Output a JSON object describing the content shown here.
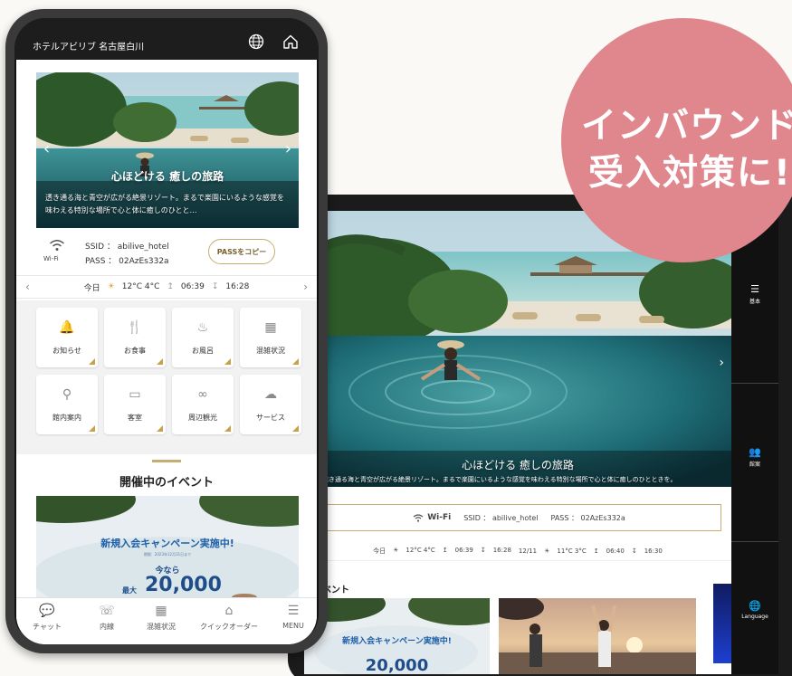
{
  "badge": {
    "line1": "インバウンド",
    "line2": "受入対策に!"
  },
  "phone": {
    "header": {
      "title": "ホテルアビリブ 名古屋白川",
      "globe_icon": "globe-icon",
      "home_icon": "home-icon"
    },
    "hero": {
      "title": "心ほどける 癒しの旅路",
      "subtitle": "透き通る海と青空が広がる絶景リゾート。まるで楽園にいるような感覚を味わえる特別な場所で心と体に癒しのひとと…",
      "prev": "‹",
      "next": "›"
    },
    "wifi": {
      "label": "Wi-Fi",
      "ssid": "SSID ： abilive_hotel",
      "pass": "PASS ： 02AzEs332a",
      "copy_button": "PASSをコピー"
    },
    "weather": {
      "day": "今日",
      "temp": "12°C 4°C",
      "sunrise": "06:39",
      "sunset": "16:28",
      "prev": "‹",
      "next": "›"
    },
    "tiles": [
      {
        "label": "お知らせ",
        "icon": "bell-icon"
      },
      {
        "label": "お食事",
        "icon": "dining-icon"
      },
      {
        "label": "お風呂",
        "icon": "bath-icon"
      },
      {
        "label": "混雑状況",
        "icon": "crowd-icon"
      },
      {
        "label": "館内案内",
        "icon": "map-icon"
      },
      {
        "label": "客室",
        "icon": "bed-icon"
      },
      {
        "label": "周辺観光",
        "icon": "binoculars-icon"
      },
      {
        "label": "サービス",
        "icon": "service-icon"
      }
    ],
    "events": {
      "title": "開催中のイベント",
      "card_title": "新規入会キャンペーン実施中!",
      "card_small": "期限：2023年12月31日まで",
      "card_now": "今なら",
      "card_max": "最大",
      "card_amount": "20,000"
    },
    "nav": [
      {
        "label": "チャット",
        "icon": "chat-icon"
      },
      {
        "label": "内線",
        "icon": "phone-icon"
      },
      {
        "label": "混雑状況",
        "icon": "crowd-icon"
      },
      {
        "label": "クイックオーダー",
        "icon": "cloche-icon"
      },
      {
        "label": "MENU",
        "icon": "menu-icon"
      }
    ]
  },
  "tablet": {
    "hero": {
      "title": "心ほどける 癒しの旅路",
      "subtitle": "透き通る海と青空が広がる絶景リゾート。まるで楽園にいるような感覚を味わえる特別な場所で心と体に癒しのひとときを。",
      "next": "›"
    },
    "wifi": {
      "label": "Wi-Fi",
      "ssid": "SSID ： abilive_hotel",
      "pass": "PASS ： 02AzEs332a"
    },
    "weather": [
      {
        "day": "今日",
        "temp": "12°C 4°C",
        "sunrise": "06:39",
        "sunset": "16:28"
      },
      {
        "day": "12/11",
        "temp": "11°C 3°C",
        "sunrise": "06:40",
        "sunset": "16:30"
      }
    ],
    "events": {
      "title": "のイベント",
      "card_title": "新規入会キャンペーン実施中!",
      "card_amount": "20,000"
    },
    "side": [
      {
        "label": "基本",
        "icon": "menu-icon"
      },
      {
        "label": "館案",
        "icon": "people-icon"
      },
      {
        "label": "Language",
        "icon": "globe-icon"
      }
    ]
  }
}
